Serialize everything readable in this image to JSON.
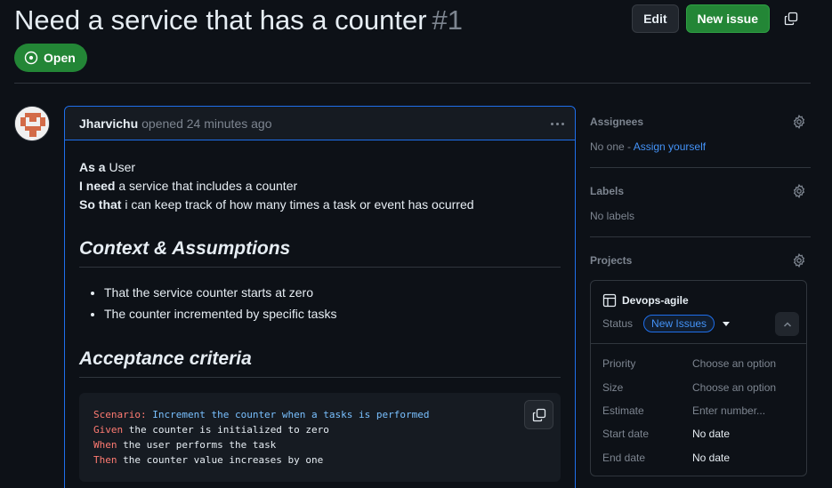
{
  "issue": {
    "title": "Need a service that has a counter",
    "number": "#1",
    "state": "Open"
  },
  "header": {
    "edit_label": "Edit",
    "new_issue_label": "New issue"
  },
  "comment": {
    "author": "Jharvichu",
    "opened_text": "opened 24 minutes ago",
    "story": [
      {
        "bold": "As a",
        "text": " User"
      },
      {
        "bold": "I need",
        "text": " a service that includes a counter"
      },
      {
        "bold": "So that",
        "text": " i can keep track of how many times a task or event has ocurred"
      }
    ],
    "context_heading": "Context & Assumptions",
    "context_items": [
      "That the service counter starts at zero",
      "The counter incremented by specific tasks"
    ],
    "acceptance_heading": "Acceptance criteria",
    "code_lines": [
      {
        "keyword": "Scenario:",
        "text": " Increment the counter when a tasks is performed"
      },
      {
        "keyword": "Given",
        "text": " the counter is initialized to zero"
      },
      {
        "keyword": "When",
        "text": " the user performs the task"
      },
      {
        "keyword": "Then",
        "text": " the counter value increases by one"
      }
    ]
  },
  "sidebar": {
    "assignees": {
      "heading": "Assignees",
      "value": "No one - ",
      "link": "Assign yourself"
    },
    "labels": {
      "heading": "Labels",
      "value": "No labels"
    },
    "projects": {
      "heading": "Projects",
      "project_name": "Devops-agile",
      "status_label": "Status",
      "status_value": "New Issues",
      "fields": [
        {
          "label": "Priority",
          "value": "Choose an option",
          "set": false
        },
        {
          "label": "Size",
          "value": "Choose an option",
          "set": false
        },
        {
          "label": "Estimate",
          "value": "Enter number...",
          "set": false
        },
        {
          "label": "Start date",
          "value": "No date",
          "set": true
        },
        {
          "label": "End date",
          "value": "No date",
          "set": true
        }
      ]
    }
  },
  "colors": {
    "accent_green": "#238636",
    "link_blue": "#4493f8",
    "code_keyword": "#ff7b72",
    "code_scenario": "#79c0ff"
  }
}
